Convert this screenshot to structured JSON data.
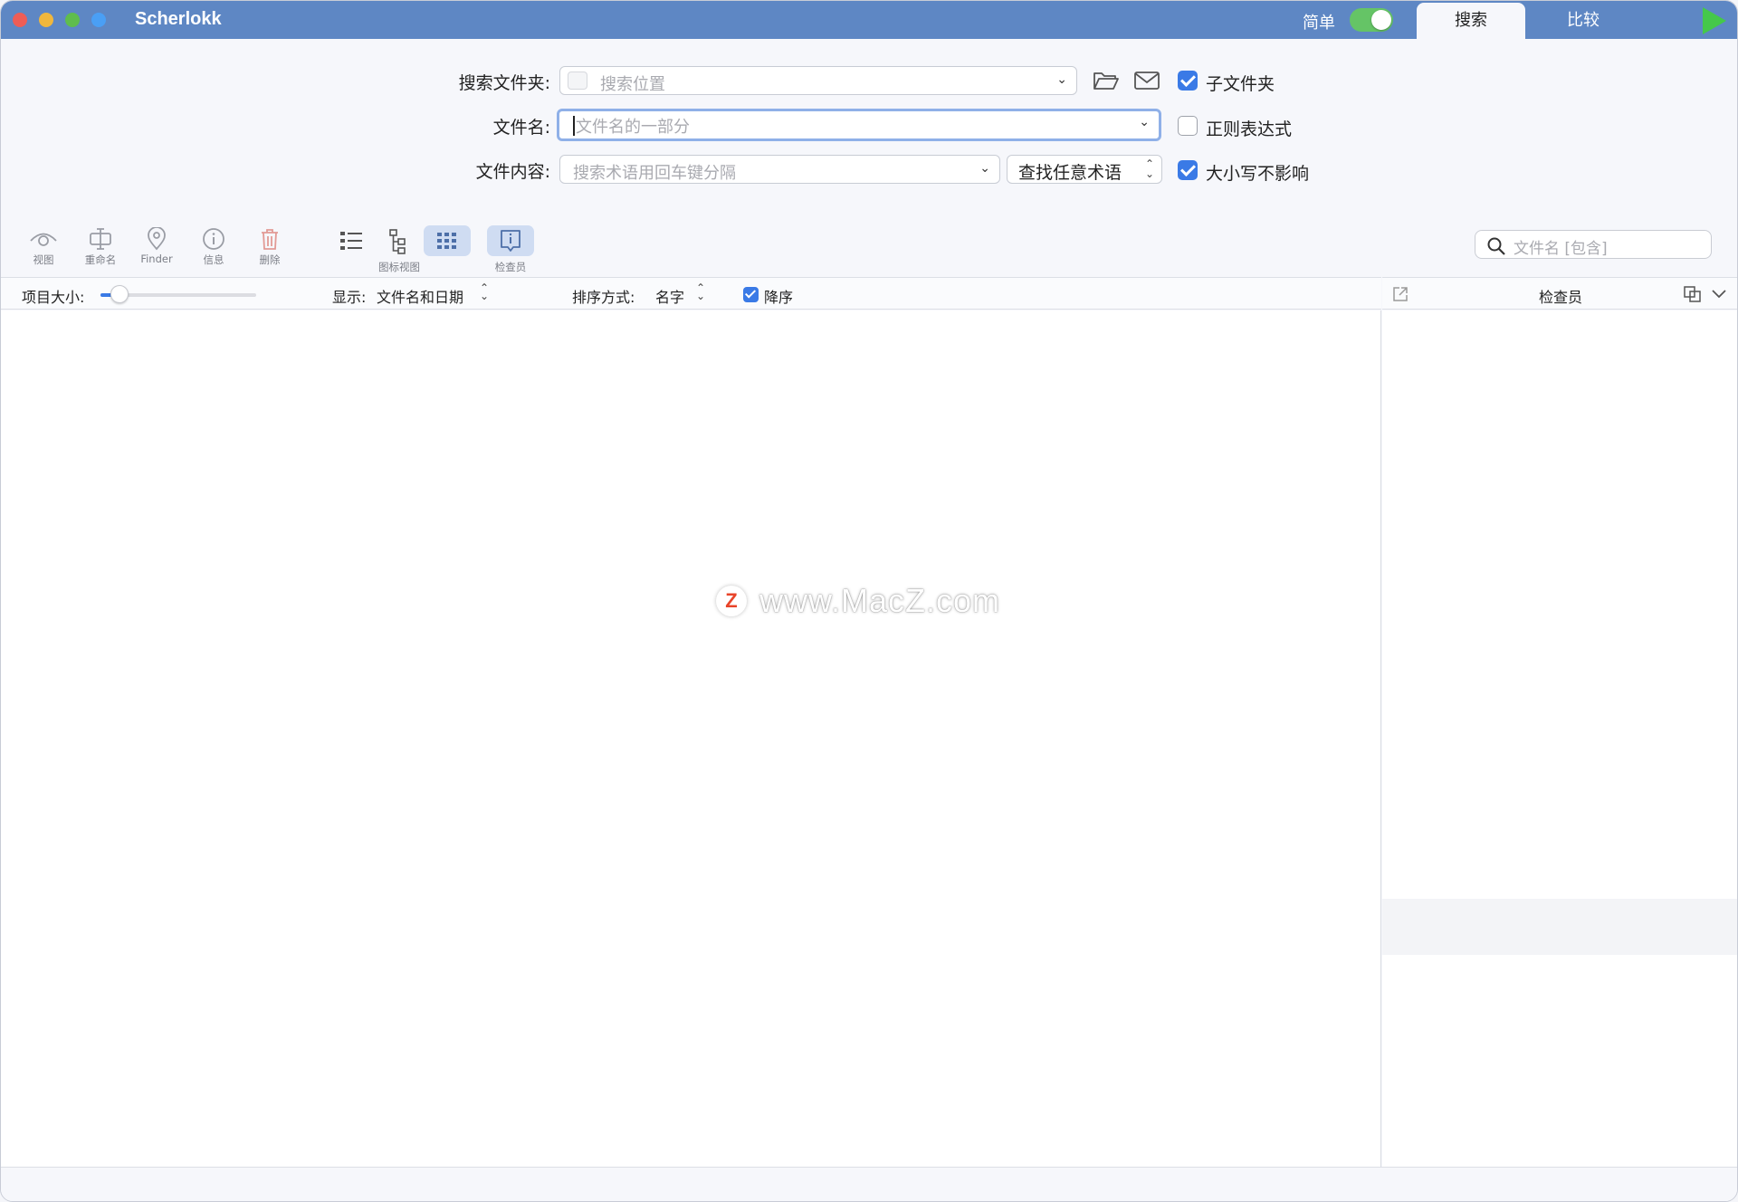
{
  "app": {
    "title": "Scherlokk"
  },
  "titlebar": {
    "simple_label": "简单",
    "simple_toggle_on": true,
    "tabs": [
      {
        "label": "搜索",
        "active": true
      },
      {
        "label": "比较",
        "active": false
      }
    ]
  },
  "form": {
    "folder": {
      "label": "搜索文件夹:",
      "placeholder": "搜索位置",
      "subfolders_label": "子文件夹",
      "subfolders_checked": true
    },
    "filename": {
      "label": "文件名:",
      "placeholder": "文件名的一部分",
      "regex_label": "正则表达式",
      "regex_checked": false
    },
    "content": {
      "label": "文件内容:",
      "placeholder": "搜索术语用回车键分隔",
      "mode": "查找任意术语",
      "case_label": "大小写不影响",
      "case_checked": true
    }
  },
  "toolbar": {
    "view": "视图",
    "rename": "重命名",
    "finder": "Finder",
    "info": "信息",
    "delete": "删除",
    "icon_view": "图标视图",
    "inspector": "检查员",
    "search_placeholder": "文件名 [包含]"
  },
  "options": {
    "item_size_label": "项目大小:",
    "item_size_value": 0.12,
    "display_label": "显示:",
    "display_value": "文件名和日期",
    "sort_label": "排序方式:",
    "sort_value": "名字",
    "descending_label": "降序",
    "descending_checked": true
  },
  "inspector": {
    "title": "检查员"
  },
  "watermark": {
    "text": "www.MacZ.com",
    "logo": "Z"
  },
  "colors": {
    "titlebar": "#5e87c4",
    "accent": "#3a7ae6",
    "toggle_on": "#65c466",
    "play": "#45c84a"
  }
}
